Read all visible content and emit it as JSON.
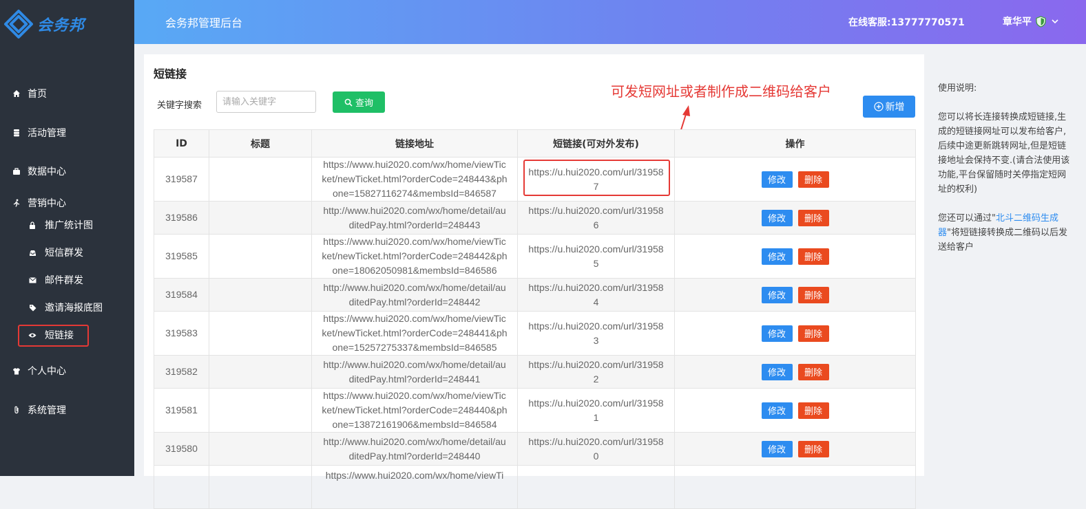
{
  "brand": {
    "logo_text": "会务邦"
  },
  "header": {
    "title": "会务邦管理后台",
    "service": "在线客服:13777770571",
    "user_name": "章华平"
  },
  "sidebar": {
    "items": [
      {
        "label": "首页",
        "icon": "home-icon"
      },
      {
        "label": "活动管理",
        "icon": "database-icon"
      },
      {
        "label": "数据中心",
        "icon": "briefcase-icon"
      },
      {
        "label": "营销中心",
        "icon": "runner-icon"
      },
      {
        "label": "推广统计图",
        "icon": "lock-icon"
      },
      {
        "label": "短信群发",
        "icon": "inbox-icon"
      },
      {
        "label": "邮件群发",
        "icon": "envelope-icon"
      },
      {
        "label": "邀请海报底图",
        "icon": "tag-icon"
      },
      {
        "label": "短链接",
        "icon": "eye-icon"
      },
      {
        "label": "个人中心",
        "icon": "shirt-icon"
      },
      {
        "label": "系统管理",
        "icon": "paperclip-icon"
      }
    ]
  },
  "page": {
    "title": "短链接",
    "search_label": "关键字搜索",
    "search_placeholder": "请输入关键字",
    "search_button": "查询",
    "add_button": "新增",
    "annotation": "可发短网址或者制作成二维码给客户"
  },
  "table": {
    "headers": [
      "ID",
      "标题",
      "链接地址",
      "短链接(可对外发布)",
      "操作"
    ],
    "edit_label": "修改",
    "delete_label": "删除",
    "rows": [
      {
        "id": "319587",
        "title": "",
        "url": "https://www.hui2020.com/wx/home/viewTicket/newTicket.html?orderCode=248443&phone=15827116274&membsId=846587",
        "short": "https://u.hui2020.com/url/319587"
      },
      {
        "id": "319586",
        "title": "",
        "url": "http://www.hui2020.com/wx/home/detail/auditedPay.html?orderId=248443",
        "short": "https://u.hui2020.com/url/319586"
      },
      {
        "id": "319585",
        "title": "",
        "url": "https://www.hui2020.com/wx/home/viewTicket/newTicket.html?orderCode=248442&phone=18062050981&membsId=846586",
        "short": "https://u.hui2020.com/url/319585"
      },
      {
        "id": "319584",
        "title": "",
        "url": "http://www.hui2020.com/wx/home/detail/auditedPay.html?orderId=248442",
        "short": "https://u.hui2020.com/url/319584"
      },
      {
        "id": "319583",
        "title": "",
        "url": "https://www.hui2020.com/wx/home/viewTicket/newTicket.html?orderCode=248441&phone=15257275337&membsId=846585",
        "short": "https://u.hui2020.com/url/319583"
      },
      {
        "id": "319582",
        "title": "",
        "url": "http://www.hui2020.com/wx/home/detail/auditedPay.html?orderId=248441",
        "short": "https://u.hui2020.com/url/319582"
      },
      {
        "id": "319581",
        "title": "",
        "url": "https://www.hui2020.com/wx/home/viewTicket/newTicket.html?orderCode=248440&phone=13872161906&membsId=846584",
        "short": "https://u.hui2020.com/url/319581"
      },
      {
        "id": "319580",
        "title": "",
        "url": "http://www.hui2020.com/wx/home/detail/auditedPay.html?orderId=248440",
        "short": "https://u.hui2020.com/url/319580"
      },
      {
        "id": "",
        "title": "",
        "url": "https://www.hui2020.com/wx/home/viewTi",
        "short": ""
      }
    ]
  },
  "help": {
    "heading": "使用说明:",
    "para1": "您可以将长连接转换成短链接,生成的短链接网址可以发布给客户,后续中途更新跳转网址,但是短链接地址会保持不变.(请合法使用该功能,平台保留随时关停指定短网址的权利)",
    "para2_prefix": "您还可以通过\"",
    "para2_link": "北斗二维码生成器",
    "para2_suffix": "\"将短链接转换成二维码以后发送给客户"
  },
  "colors": {
    "sidebar_bg": "#2b323c",
    "header_gradient_start": "#58a9f5",
    "header_gradient_end": "#8a68ee",
    "search_green": "#1fbf66",
    "primary_blue": "#2d8cf0",
    "danger_orange": "#ea4a1f",
    "annotation_red": "#e53935"
  }
}
